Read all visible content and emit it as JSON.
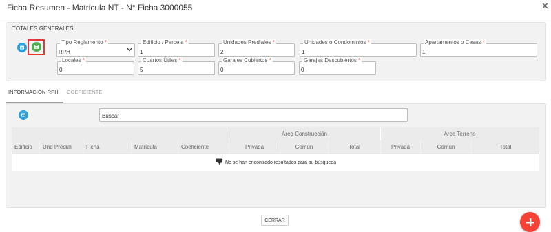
{
  "dialog": {
    "title": "Ficha Resumen - Matricula NT - N° Ficha 3000055",
    "close_glyph": "✕"
  },
  "totales": {
    "title": "TOTALES GENERALES",
    "required_mark": "*",
    "icons": [
      "expand-icon",
      "save-icon"
    ],
    "fields": [
      {
        "label": "Tipo Reglamento",
        "value": "RPH",
        "type": "select"
      },
      {
        "label": "Edificio / Parcela",
        "value": "1"
      },
      {
        "label": "Unidades Prediales",
        "value": "2"
      },
      {
        "label": "Unidades o Condominios",
        "value": "1"
      },
      {
        "label": "Apartamentos o Casas",
        "value": "1"
      },
      {
        "label": "Locales",
        "value": "0"
      },
      {
        "label": "Cuartos Útiles",
        "value": "5"
      },
      {
        "label": "Garajes Cubiertos",
        "value": "0"
      },
      {
        "label": "Garajes Descubiertos",
        "value": "0"
      }
    ]
  },
  "tabs": [
    {
      "label": "INFORMACIÓN RPH",
      "active": true
    },
    {
      "label": "COEFICIENTE",
      "active": false
    }
  ],
  "table": {
    "search_placeholder": "Buscar",
    "group_headers": [
      "Área Construcción",
      "Área Terreno"
    ],
    "columns": [
      "Edificio",
      "Und Predial",
      "Ficha",
      "Matrícula",
      "Coeficiente",
      "Privada",
      "Común",
      "Total",
      "Privada",
      "Común",
      "Total"
    ],
    "empty_message": "No se han encontrado resultados para su búsqueda",
    "rows": []
  },
  "footer": {
    "close_label": "CERRAR",
    "fab_glyph": "+"
  },
  "colors": {
    "accent_blue": "#29a3e0",
    "save_green": "#4caf50",
    "highlight_red": "#e53935",
    "fab_red": "#f44336",
    "panel_bg": "#f2f2f2"
  }
}
